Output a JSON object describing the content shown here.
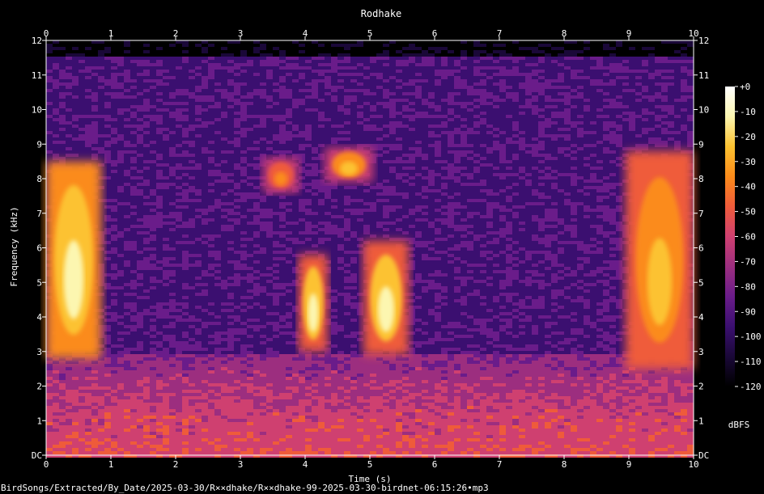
{
  "chart_data": {
    "type": "heatmap",
    "title": "Rodhake",
    "xlabel": "Time (s)",
    "ylabel": "Frequency (kHz)",
    "xlim": [
      0,
      10
    ],
    "ylim": [
      0,
      12
    ],
    "x_ticks": [
      "0",
      "1",
      "2",
      "3",
      "4",
      "5",
      "6",
      "7",
      "8",
      "9",
      "10"
    ],
    "y_ticks": [
      "DC",
      "1",
      "2",
      "3",
      "4",
      "5",
      "6",
      "7",
      "8",
      "9",
      "10",
      "11",
      "12"
    ],
    "colorbar": {
      "label": "dBFS",
      "range": [
        -120,
        0
      ],
      "ticks": [
        "+0",
        "-10",
        "-20",
        "-30",
        "-40",
        "-50",
        "-60",
        "-70",
        "-80",
        "-90",
        "-100",
        "-110",
        "-120"
      ]
    },
    "grid": false,
    "colormap": [
      "#000000",
      "#1a0838",
      "#3b0f70",
      "#6a1c8a",
      "#9c2e7f",
      "#cf4070",
      "#ef5b3a",
      "#fb8b1a",
      "#fcc230",
      "#fcf6b0",
      "#ffffff"
    ],
    "note_path": "BirdSongs/Extracted/By_Date/2025-03-30/R××dhake/R××dhake-99-2025-03-30-birdnet-06:15:26•mp3",
    "calls": [
      {
        "t0": 0.0,
        "t1": 0.85,
        "f0": 2.8,
        "f1": 8.5,
        "level": -15
      },
      {
        "t0": 3.35,
        "t1": 3.9,
        "f0": 7.6,
        "f1": 8.6,
        "level": -40
      },
      {
        "t0": 3.9,
        "t1": 4.35,
        "f0": 3.0,
        "f1": 5.8,
        "level": -18
      },
      {
        "t0": 4.3,
        "t1": 5.05,
        "f0": 7.9,
        "f1": 8.9,
        "level": -30
      },
      {
        "t0": 4.9,
        "t1": 5.6,
        "f0": 2.9,
        "f1": 6.2,
        "level": -18
      },
      {
        "t0": 8.95,
        "t1": 10.0,
        "f0": 2.5,
        "f1": 8.8,
        "level": -25
      }
    ]
  }
}
